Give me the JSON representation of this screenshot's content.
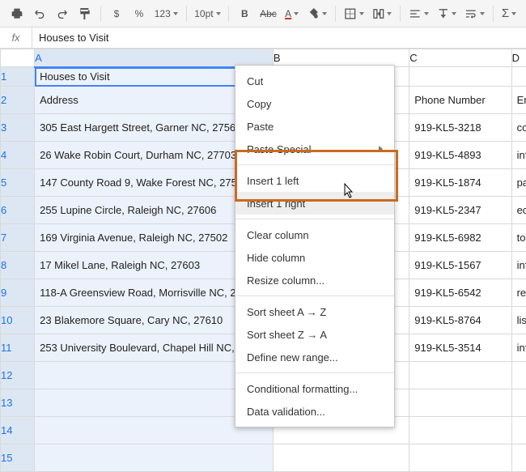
{
  "toolbar": {
    "currency": "$",
    "percent": "%",
    "num123": "123",
    "fontsize": "10pt",
    "bold": "B",
    "strike": "Abc",
    "textcolor": "A",
    "fillcolor": "A"
  },
  "formula": {
    "fx": "fx",
    "value": "Houses to Visit"
  },
  "headers": {
    "A": "A",
    "B": "B",
    "C": "C",
    "D": "D"
  },
  "rows": [
    {
      "num": "1",
      "a": "Houses to Visit",
      "b": "",
      "c": "",
      "d": ""
    },
    {
      "num": "2",
      "a": "Address",
      "b": "",
      "c": "Phone Number",
      "d": "Email"
    },
    {
      "num": "3",
      "a": "305 East Hargett Street, Garner NC, 27568",
      "b": "",
      "c": "919-KL5-3218",
      "d": "contact@s"
    },
    {
      "num": "4",
      "a": "26 Wake Robin Court, Durham NC, 27703",
      "b": "",
      "c": "919-KL5-4893",
      "d": "info@preiss"
    },
    {
      "num": "5",
      "a": "147 County Road 9, Wake Forest NC, 27580",
      "b": "",
      "c": "919-KL5-1874",
      "d": "partners@h"
    },
    {
      "num": "6",
      "a": "255 Lupine Circle, Raleigh NC, 27606",
      "b": "",
      "c": "919-KL5-2347",
      "d": "ecrealty@e"
    },
    {
      "num": "7",
      "a": "169 Virginia Avenue, Raleigh NC, 27502",
      "b": "",
      "c": "919-KL5-6982",
      "d": "tom@boyla"
    },
    {
      "num": "8",
      "a": "17 Mikel Lane, Raleigh NC, 27603",
      "b": "",
      "c": "919-KL5-1567",
      "d": "info@glena"
    },
    {
      "num": "9",
      "a": "118-A Greensview Road, Morrisville NC, 27540",
      "b": "",
      "c": "919-KL5-6542",
      "d": "realty@hur"
    },
    {
      "num": "10",
      "a": "23 Blakemore Square, Cary NC, 27610",
      "b": "",
      "c": "919-KL5-8764",
      "d": "lisa@fmrea"
    },
    {
      "num": "11",
      "a": "253 University Boulevard, Chapel Hill NC, 27514",
      "b": "",
      "c": "919-KL5-3514",
      "d": "info@leathe"
    },
    {
      "num": "12",
      "a": "",
      "b": "",
      "c": "",
      "d": ""
    },
    {
      "num": "13",
      "a": "",
      "b": "",
      "c": "",
      "d": ""
    },
    {
      "num": "14",
      "a": "",
      "b": "",
      "c": "",
      "d": ""
    },
    {
      "num": "15",
      "a": "",
      "b": "",
      "c": "",
      "d": ""
    }
  ],
  "menu": {
    "cut": "Cut",
    "copy": "Copy",
    "paste": "Paste",
    "paste_special": "Paste Special",
    "insert_left": "Insert 1 left",
    "insert_right": "Insert 1 right",
    "clear_column": "Clear column",
    "hide_column": "Hide column",
    "resize_column": "Resize column...",
    "sort_az": "Sort sheet A → Z",
    "sort_za": "Sort sheet Z → A",
    "define_range": "Define new range...",
    "cond_format": "Conditional formatting...",
    "data_validation": "Data validation..."
  }
}
